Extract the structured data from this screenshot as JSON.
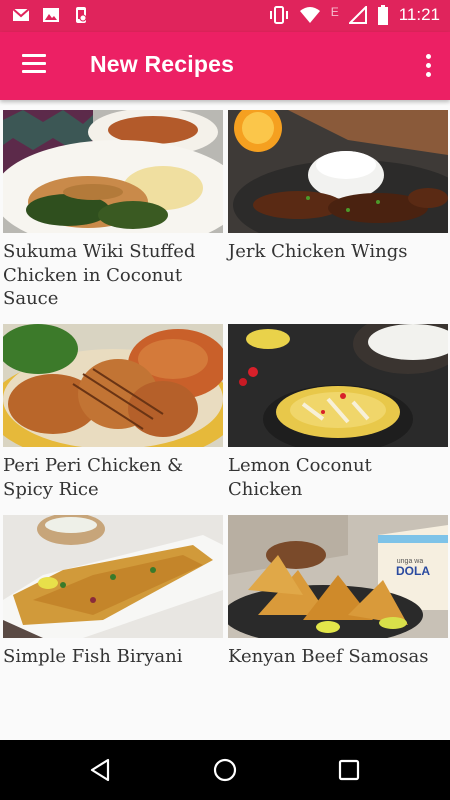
{
  "status_bar": {
    "time": "11:21",
    "network_letter": "E",
    "icons": [
      "gmail-icon",
      "photo-icon",
      "phone-app-icon",
      "vibrate-icon",
      "wifi-icon",
      "signal-icon",
      "battery-icon"
    ]
  },
  "app_bar": {
    "title": "New Recipes",
    "menu_icon": "hamburger-menu-icon",
    "overflow_icon": "more-vert-icon"
  },
  "recipes": [
    {
      "title": "Sukuma Wiki Stuffed Chicken in Coconut Sauce",
      "image": "stuffed-chicken-photo"
    },
    {
      "title": "Jerk Chicken Wings",
      "image": "jerk-chicken-photo"
    },
    {
      "title": "Peri Peri Chicken & Spicy Rice",
      "image": "peri-peri-chicken-photo"
    },
    {
      "title": "Lemon Coconut Chicken",
      "image": "lemon-coconut-chicken-photo"
    },
    {
      "title": "Simple Fish Biryani",
      "image": "fish-biryani-photo"
    },
    {
      "title": "Kenyan Beef Samosas",
      "image": "beef-samosas-photo"
    }
  ],
  "photo_text": {
    "samosa_bag_small": "unga wa",
    "samosa_bag_brand": "DOLA"
  },
  "nav_bar": {
    "buttons": [
      "back-icon",
      "home-icon",
      "recents-icon"
    ]
  },
  "colors": {
    "status_bar": "#e0245c",
    "app_bar": "#ec2064",
    "background": "#fafafa",
    "nav_bar": "#000000"
  }
}
